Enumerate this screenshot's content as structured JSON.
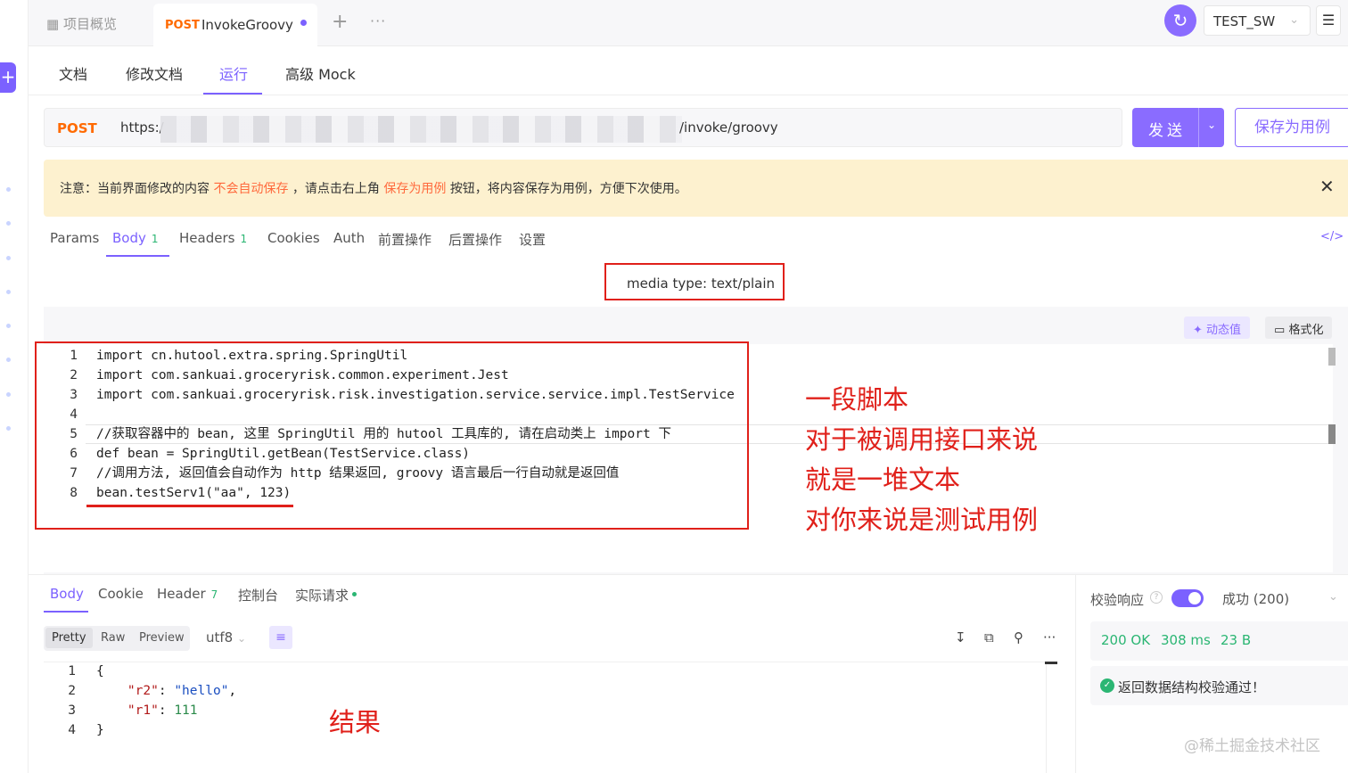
{
  "top": {
    "overview_tab": "项目概览",
    "active_tab_method": "POST",
    "active_tab_name": "InvokeGroovy",
    "new_tab": "+",
    "more": "···",
    "env": "TEST_SW"
  },
  "subtabs": [
    "文档",
    "修改文档",
    "运行",
    "高级 Mock"
  ],
  "request": {
    "method": "POST",
    "url_prefix": "https:/",
    "url_suffix": "/invoke/groovy",
    "send_label": "发送",
    "save_label": "保存为用例"
  },
  "notice": {
    "part1": "注意：当前界面修改的内容",
    "highlight1": "不会自动保存",
    "part2": "，请点击右上角",
    "highlight2": "保存为用例",
    "part3": "按钮，将内容保存为用例，方便下次使用。"
  },
  "req_tabs": [
    {
      "label": "Params",
      "count": ""
    },
    {
      "label": "Body",
      "count": "1"
    },
    {
      "label": "Headers",
      "count": "1"
    },
    {
      "label": "Cookies",
      "count": ""
    },
    {
      "label": "Auth",
      "count": ""
    },
    {
      "label": "前置操作",
      "count": ""
    },
    {
      "label": "后置操作",
      "count": ""
    },
    {
      "label": "设置",
      "count": ""
    }
  ],
  "media_type": "media type: text/plain",
  "editor": {
    "dynamic_btn": "动态值",
    "format_btn": "格式化",
    "lines": [
      {
        "n": "1",
        "code": "import cn.hutool.extra.spring.SpringUtil"
      },
      {
        "n": "2",
        "code": "import com.sankuai.groceryrisk.common.experiment.Jest"
      },
      {
        "n": "3",
        "code": "import com.sankuai.groceryrisk.risk.investigation.service.service.impl.TestService"
      },
      {
        "n": "4",
        "code": ""
      },
      {
        "n": "5",
        "code": "//获取容器中的 bean, 这里 SpringUtil 用的 hutool 工具库的, 请在启动类上 import 下"
      },
      {
        "n": "6",
        "code": "def bean = SpringUtil.getBean(TestService.class)"
      },
      {
        "n": "7",
        "code": "//调用方法, 返回值会自动作为 http 结果返回, groovy 语言最后一行自动就是返回值"
      },
      {
        "n": "8",
        "code": "bean.testServ1(\"aa\", 123)"
      }
    ]
  },
  "annotations": [
    "一段脚本",
    "对于被调用接口来说",
    "就是一堆文本",
    "对你来说是测试用例"
  ],
  "response": {
    "tabs": [
      {
        "label": "Body",
        "count": ""
      },
      {
        "label": "Cookie",
        "count": ""
      },
      {
        "label": "Header",
        "count": "7"
      },
      {
        "label": "控制台",
        "count": ""
      },
      {
        "label": "实际请求",
        "count": ""
      }
    ],
    "modes": [
      "Pretty",
      "Raw",
      "Preview"
    ],
    "encoding": "utf8",
    "json_lines": [
      {
        "n": "1",
        "code": "{"
      },
      {
        "n": "2",
        "key": "\"r2\"",
        "val": "\"hello\"",
        "tail": ","
      },
      {
        "n": "3",
        "key": "\"r1\"",
        "num": "111"
      },
      {
        "n": "4",
        "code": "}"
      }
    ],
    "result_label": "结果"
  },
  "validation": {
    "title": "校验响应",
    "status": "成功 (200)",
    "code": "200 OK",
    "time": "308 ms",
    "size": "23 B",
    "message": "返回数据结构校验通过！"
  },
  "watermark": "@稀土掘金技术社区"
}
